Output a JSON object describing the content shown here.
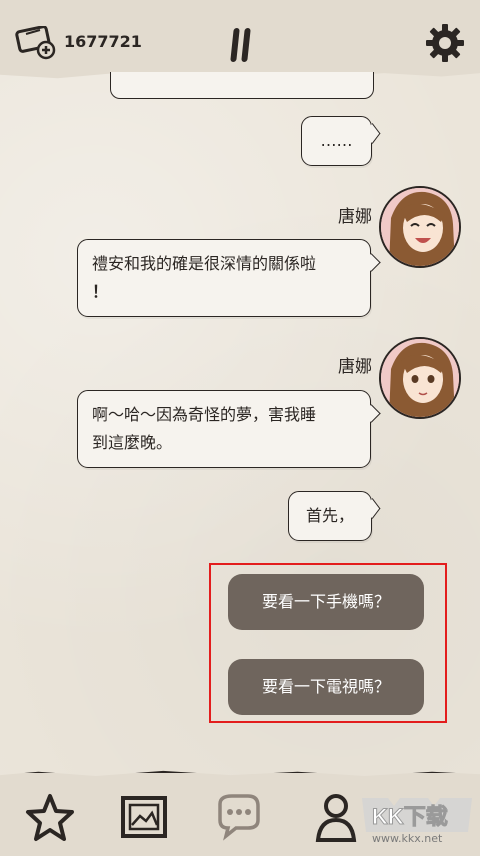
{
  "header": {
    "coin_count": "1677721"
  },
  "chat": {
    "messages": [
      {
        "side": "right",
        "text": "……"
      },
      {
        "side": "left",
        "speaker": "唐娜",
        "text_line1": "禮安和我的確是很深情的關係啦",
        "text_line2": "！"
      },
      {
        "side": "left",
        "speaker": "唐娜",
        "text_line1": "啊～哈～因為奇怪的夢，害我睡",
        "text_line2": "到這麼晚。"
      },
      {
        "side": "right",
        "text": "首先，"
      }
    ]
  },
  "choices": [
    {
      "label": "要看一下手機嗎？"
    },
    {
      "label": "要看一下電視嗎？"
    }
  ],
  "watermark": {
    "text": "www.kkx.net",
    "logo": "KK下载"
  },
  "colors": {
    "accent_frame": "#e31d1d",
    "choice_bg": "#6f655d",
    "bubble_bg": "#f6f3ee",
    "ink": "#2b2623"
  },
  "icons": {
    "top_left": "ticket-icon",
    "pause": "pause-icon",
    "settings": "gear-icon",
    "nav": [
      "star-icon",
      "photo-icon",
      "chat-icon",
      "person-icon"
    ]
  }
}
